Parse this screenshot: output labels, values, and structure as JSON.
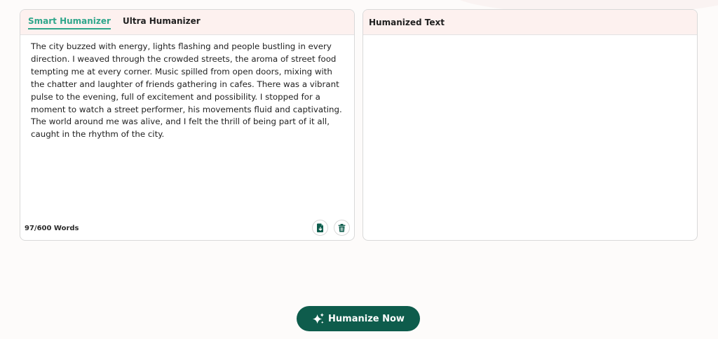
{
  "colors": {
    "accent": "#2fa68b",
    "primary_button": "#0e5c4c",
    "header_bg": "#fdf1ef"
  },
  "input_panel": {
    "tabs": [
      {
        "label": "Smart Humanizer",
        "active": true
      },
      {
        "label": "Ultra Humanizer",
        "active": false
      }
    ],
    "text": "The city buzzed with energy, lights flashing and people bustling in every direction. I weaved through the crowded streets, the aroma of street food tempting me at every corner. Music spilled from open doors, mixing with the chatter and laughter of friends gathering in cafes. There was a vibrant pulse to the evening, full of excitement and possibility. I stopped for a moment to watch a street performer, his movements fluid and captivating. The world around me was alive, and I felt the thrill of being part of it all, caught in the rhythm of the city.",
    "word_count": "97/600 Words",
    "icons": {
      "paste": "paste-document-icon",
      "delete": "trash-icon"
    }
  },
  "output_panel": {
    "title": "Humanized Text",
    "text": ""
  },
  "actions": {
    "humanize_label": "Humanize Now",
    "humanize_icon": "sparkles-icon"
  }
}
